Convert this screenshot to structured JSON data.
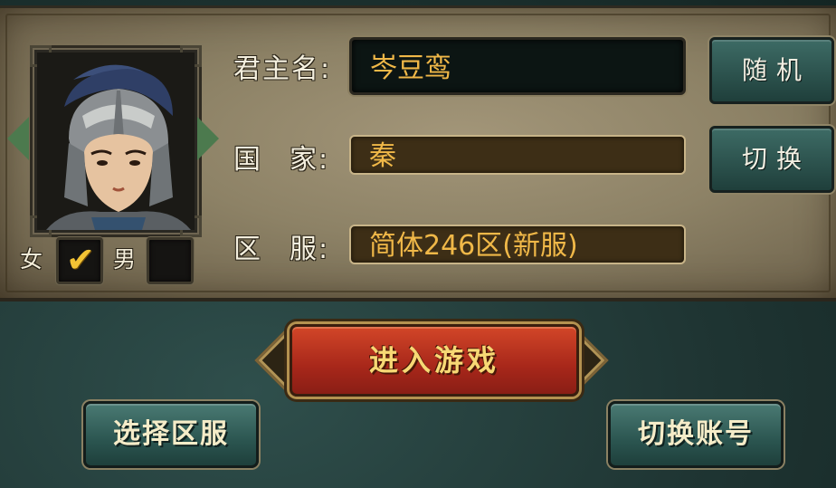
{
  "character": {
    "portrait_name": "helmeted-warrior-portrait",
    "gender": {
      "female_label": "女",
      "male_label": "男",
      "female_checked": true,
      "male_checked": false,
      "check_glyph": "✔"
    }
  },
  "form": {
    "name_label": "君主名:",
    "name_value": "岑豆鸾",
    "country_label_a": "国",
    "country_label_b": "家:",
    "country_value": "秦",
    "server_label_a": "区",
    "server_label_b": "服:",
    "server_value": "简体246区(新服)"
  },
  "buttons": {
    "random": "随机",
    "switch_country": "切换",
    "enter_game": "进入游戏",
    "select_server": "选择区服",
    "switch_account": "切换账号"
  },
  "colors": {
    "accent_gold": "#f0b848",
    "enter_red": "#c03a22",
    "teal_button": "#2b5550",
    "arrow_green": "#4c7a4e"
  }
}
